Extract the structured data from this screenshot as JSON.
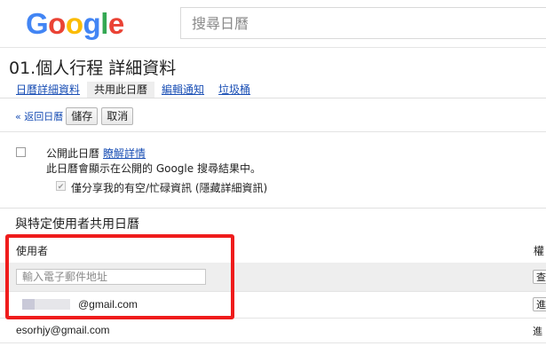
{
  "header": {
    "logo_letters": [
      {
        "char": "G",
        "color": "#4285F4"
      },
      {
        "char": "o",
        "color": "#EA4335"
      },
      {
        "char": "o",
        "color": "#FBBC05"
      },
      {
        "char": "g",
        "color": "#4285F4"
      },
      {
        "char": "l",
        "color": "#34A853"
      },
      {
        "char": "e",
        "color": "#EA4335"
      }
    ],
    "search_placeholder": "搜尋日曆"
  },
  "page_title": "01.個人行程 詳細資料",
  "tabs": [
    {
      "label": "日曆詳細資料",
      "active": false
    },
    {
      "label": "共用此日曆",
      "active": true
    },
    {
      "label": "編輯通知",
      "active": false
    },
    {
      "label": "垃圾桶",
      "active": false
    }
  ],
  "actions": {
    "back_label": "« 返回日曆",
    "save_label": "儲存",
    "cancel_label": "取消"
  },
  "public": {
    "label": "公開此日曆",
    "learn_more": "瞭解詳情",
    "description": "此日曆會顯示在公開的 Google 搜尋結果中。",
    "checked": false,
    "busy_only_label": "僅分享我的有空/忙碌資訊 (隱藏詳細資訊)",
    "busy_only_checked": true,
    "checkmark": "✔"
  },
  "share": {
    "section_title": "與特定使用者共用日曆",
    "column_user": "使用者",
    "column_permission": "權",
    "add_placeholder": "輸入電子郵件地址",
    "add_button": "查看",
    "users": [
      {
        "email": "@gmail.com",
        "permission_button": "進"
      },
      {
        "email": "esorhjy@gmail.com",
        "permission": "進"
      }
    ]
  },
  "colors": {
    "link": "#1a4fb5",
    "highlight_border": "#ef1c1c",
    "row_bg": "#eeeeee"
  }
}
